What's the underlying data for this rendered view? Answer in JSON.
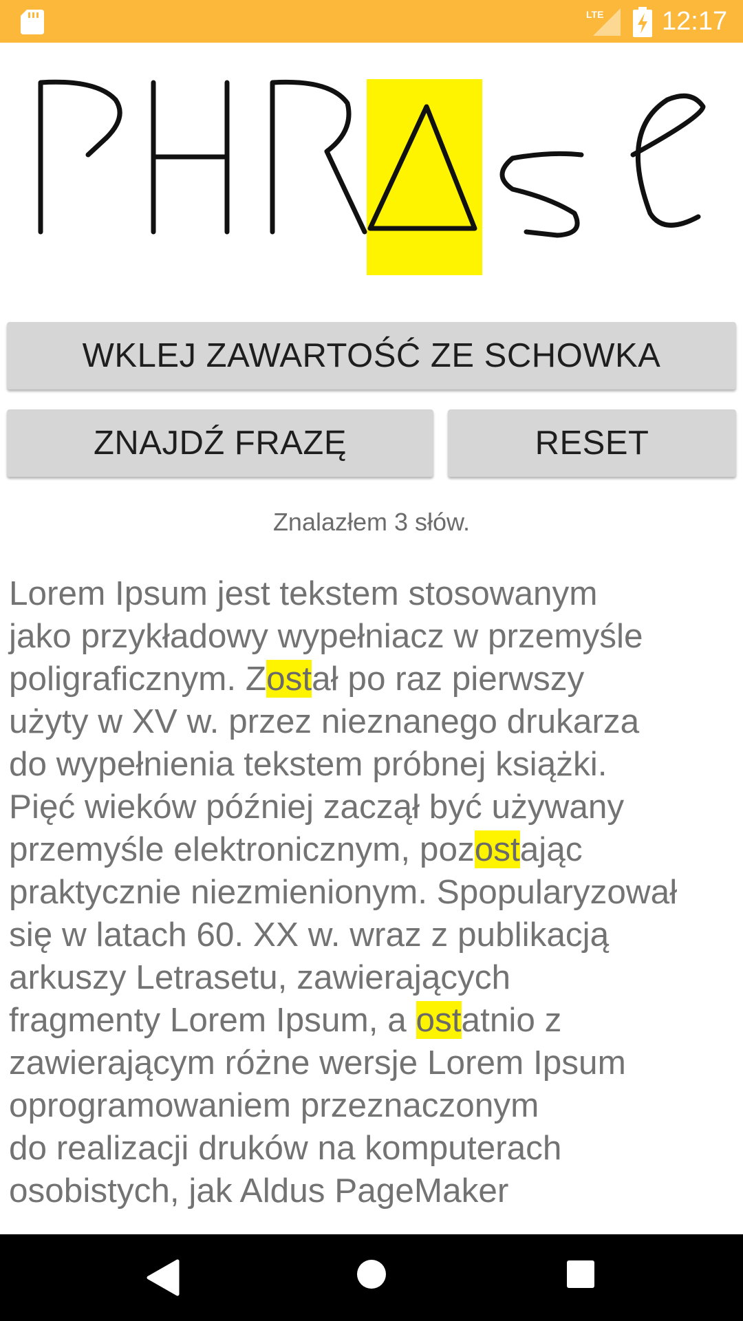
{
  "status_bar": {
    "time": "12:17",
    "network_label": "LTE",
    "background_color": "#FBB83B",
    "icons": [
      "sd-card-icon",
      "lte-signal-icon",
      "battery-charging-icon"
    ]
  },
  "logo": {
    "text": "PHRASE",
    "highlight_color": "#FFF400"
  },
  "buttons": {
    "paste_label": "WKLEJ ZAWARTOŚĆ ZE SCHOWKA",
    "find_label": "ZNAJDŹ FRAZĘ",
    "reset_label": "RESET"
  },
  "result_message": "Znalazłem 3 słów.",
  "highlight_color": "#FFF400",
  "content_lines": [
    [
      {
        "t": "Lorem Ipsum jest tekstem stosowanym"
      }
    ],
    [
      {
        "t": "jako przykładowy wypełniacz w przemyśle"
      }
    ],
    [
      {
        "t": "poligraficznym. Z"
      },
      {
        "t": "ost",
        "hl": true
      },
      {
        "t": "ał po raz pierwszy"
      }
    ],
    [
      {
        "t": "użyty w XV w. przez nieznanego drukarza"
      }
    ],
    [
      {
        "t": "do wypełnienia tekstem próbnej książki."
      }
    ],
    [
      {
        "t": "Pięć wieków później zaczął być używany"
      }
    ],
    [
      {
        "t": "przemyśle elektronicznym, poz"
      },
      {
        "t": "ost",
        "hl": true
      },
      {
        "t": "ając"
      }
    ],
    [
      {
        "t": "praktycznie niezmienionym. Spopularyzował"
      }
    ],
    [
      {
        "t": "się w latach 60. XX w. wraz z publikacją"
      }
    ],
    [
      {
        "t": "arkuszy Letrasetu, zawierających"
      }
    ],
    [
      {
        "t": "fragmenty Lorem Ipsum, a "
      },
      {
        "t": "ost",
        "hl": true
      },
      {
        "t": "atnio z"
      }
    ],
    [
      {
        "t": "zawierającym różne wersje Lorem Ipsum"
      }
    ],
    [
      {
        "t": "oprogramowaniem przeznaczonym"
      }
    ],
    [
      {
        "t": "do realizacji druków na komputerach"
      }
    ],
    [
      {
        "t": "osobistych, jak Aldus PageMaker"
      }
    ]
  ],
  "nav_bar": {
    "icons": [
      "back-icon",
      "home-icon",
      "recents-icon"
    ]
  }
}
